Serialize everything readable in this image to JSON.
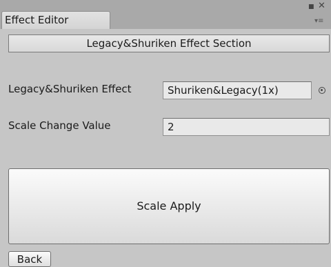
{
  "window": {
    "tab_title": "Effect Editor",
    "maximize_glyph": "■",
    "close_glyph": "✕",
    "menu_glyph": "▾≡"
  },
  "section": {
    "header": "Legacy&Shuriken Effect Section"
  },
  "effect_field": {
    "label": "Legacy&Shuriken Effect",
    "value": "Shuriken&Legacy(1x)"
  },
  "scale_field": {
    "label": "Scale Change Value",
    "value": "2"
  },
  "buttons": {
    "scale_apply": "Scale Apply",
    "back": "Back"
  },
  "icons": {
    "object_picker": "object-picker-icon"
  }
}
